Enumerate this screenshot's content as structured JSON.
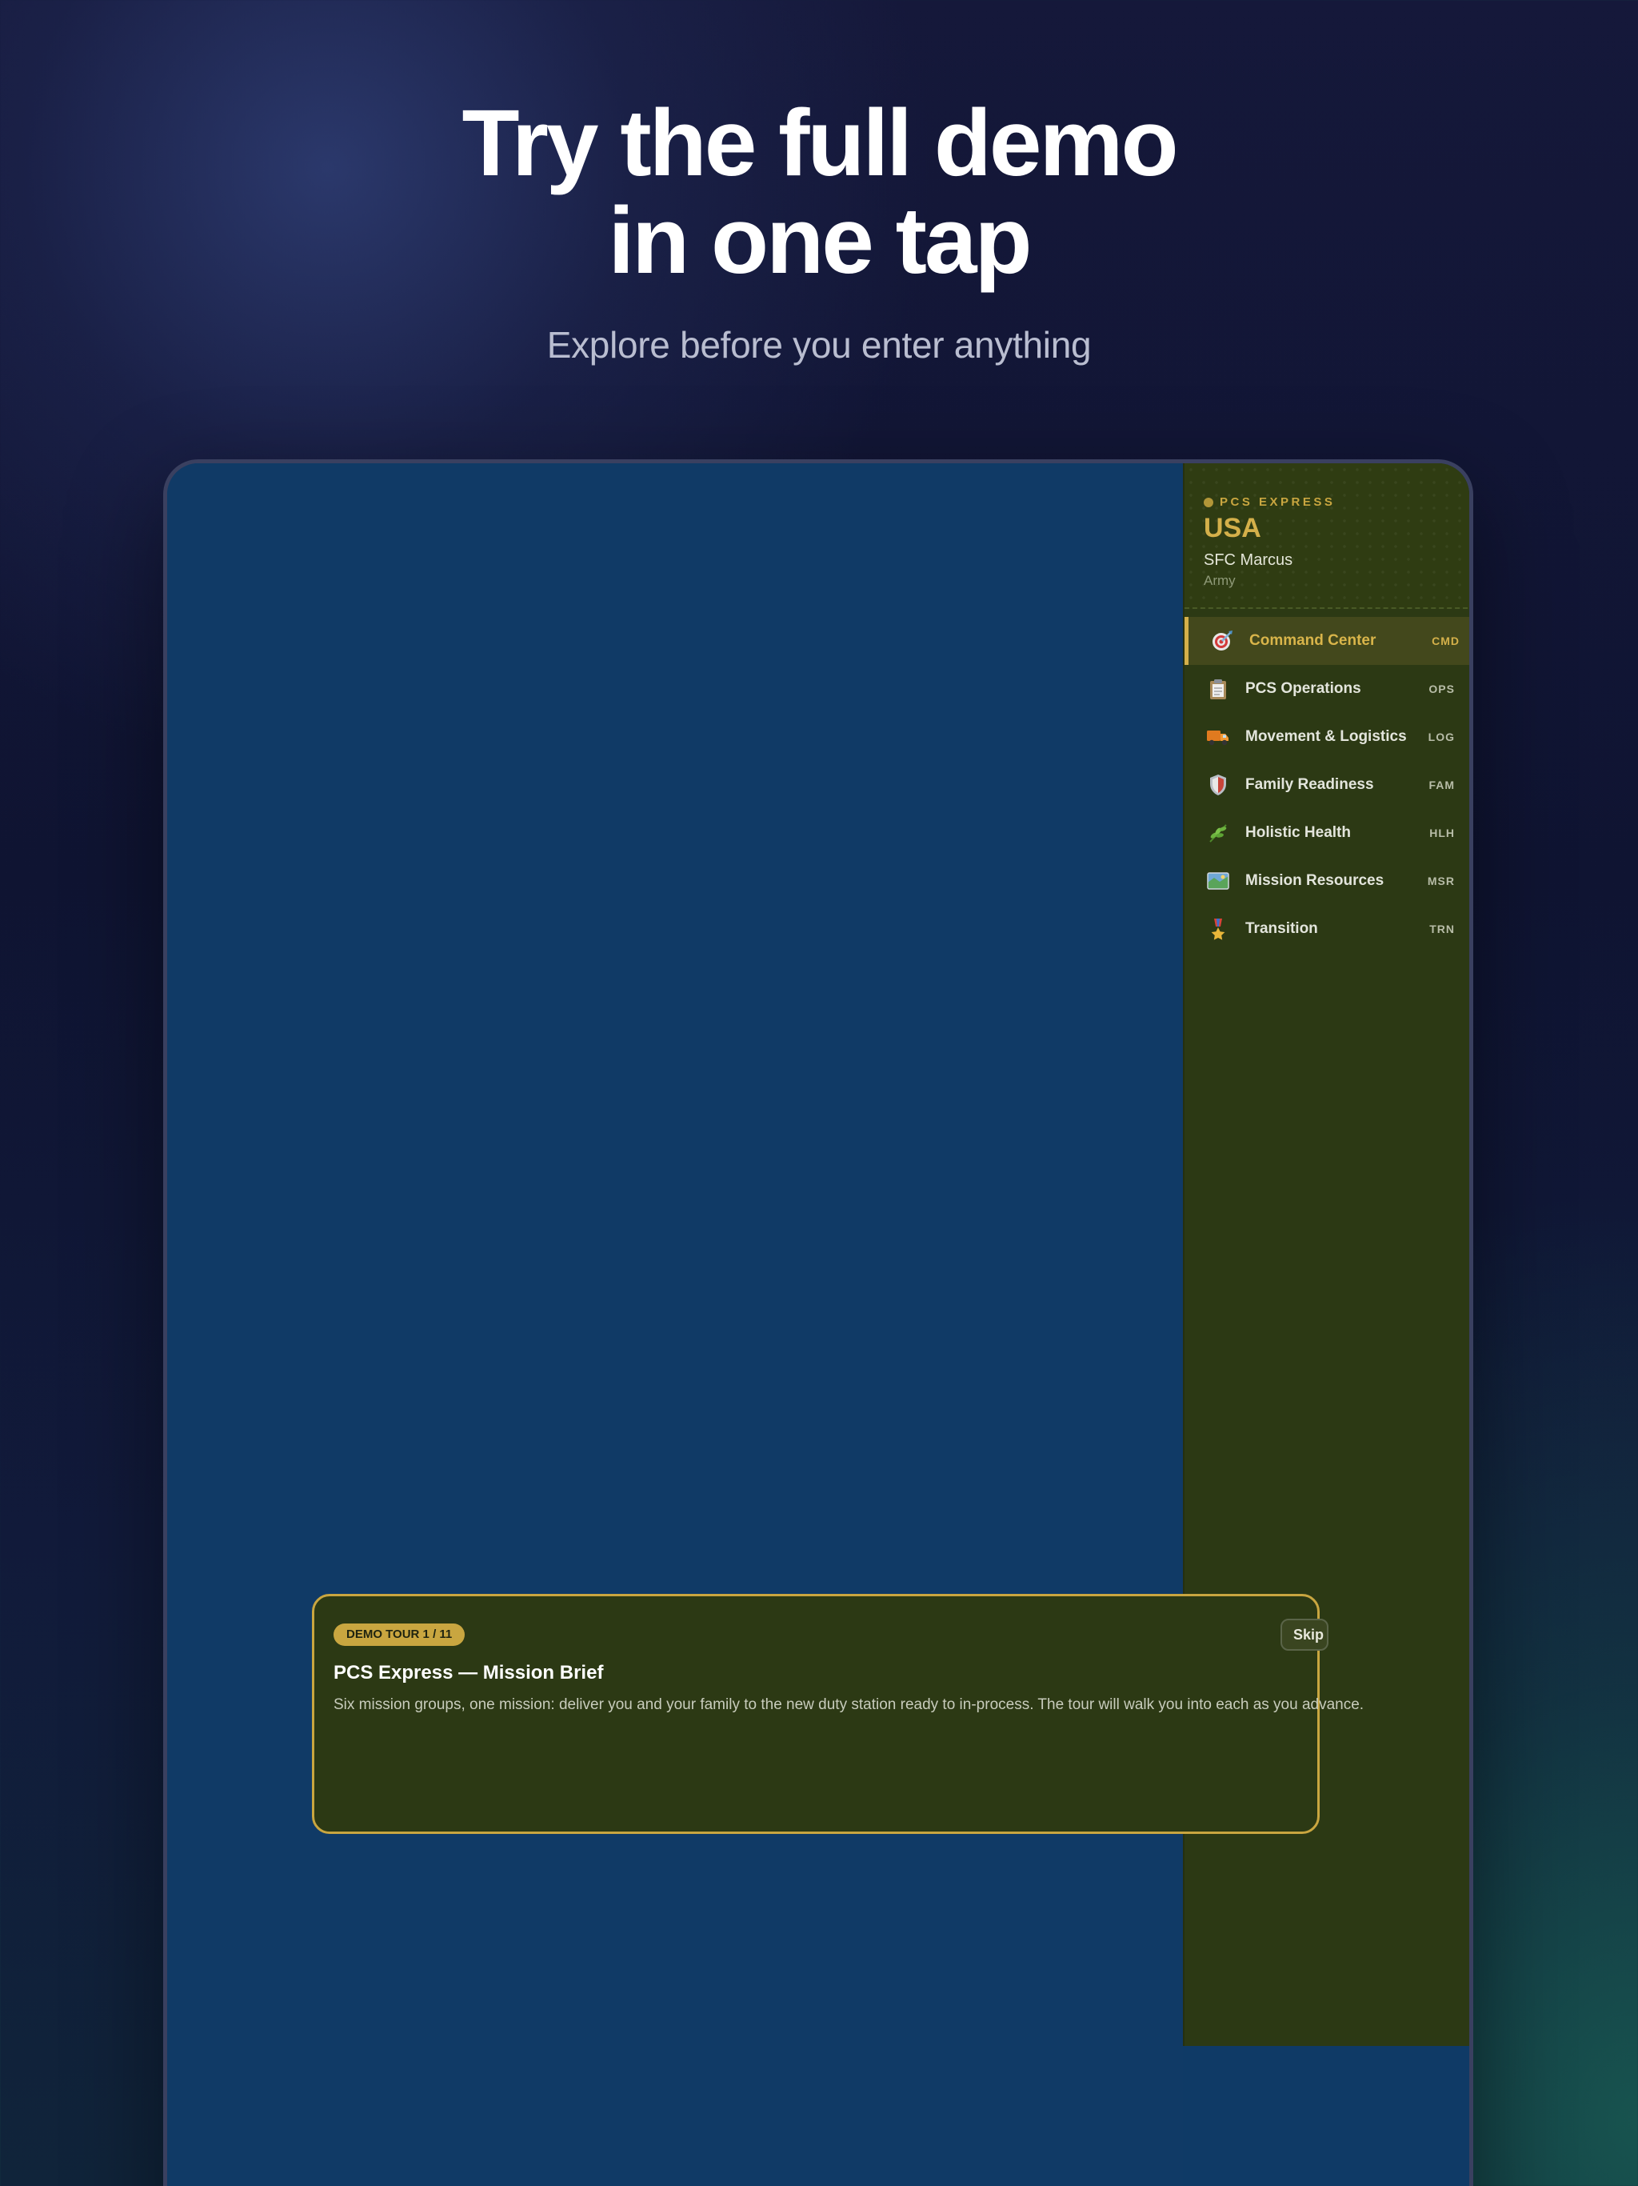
{
  "hero": {
    "title_line1": "Try the full demo",
    "title_line2": "in one tap",
    "subtitle": "Explore before you enter anything"
  },
  "sidebar": {
    "brand": "PCS EXPRESS",
    "country": "USA",
    "user_name": "SFC Marcus",
    "branch": "Army",
    "items": [
      {
        "icon": "target-icon",
        "label": "Command Center",
        "code": "CMD",
        "active": true
      },
      {
        "icon": "clipboard-icon",
        "label": "PCS Operations",
        "code": "OPS",
        "active": false
      },
      {
        "icon": "truck-icon",
        "label": "Movement & Logistics",
        "code": "LOG",
        "active": false
      },
      {
        "icon": "shield-icon",
        "label": "Family Readiness",
        "code": "FAM",
        "active": false
      },
      {
        "icon": "herb-icon",
        "label": "Holistic Health",
        "code": "HLH",
        "active": false
      },
      {
        "icon": "map-icon",
        "label": "Mission Resources",
        "code": "MSR",
        "active": false
      },
      {
        "icon": "medal-icon",
        "label": "Transition",
        "code": "TRN",
        "active": false
      }
    ]
  },
  "tour": {
    "badge": "DEMO TOUR 1 / 11",
    "skip_label": "Skip",
    "title": "PCS Express — Mission Brief",
    "body": "Six mission groups, one mission: deliver you and your family to the new duty station ready to in-process. The tour will walk you into each as you advance."
  },
  "colors": {
    "accent_gold": "#c9a640",
    "sidebar_bg": "#2c3914",
    "screen_bg": "#103a66"
  }
}
